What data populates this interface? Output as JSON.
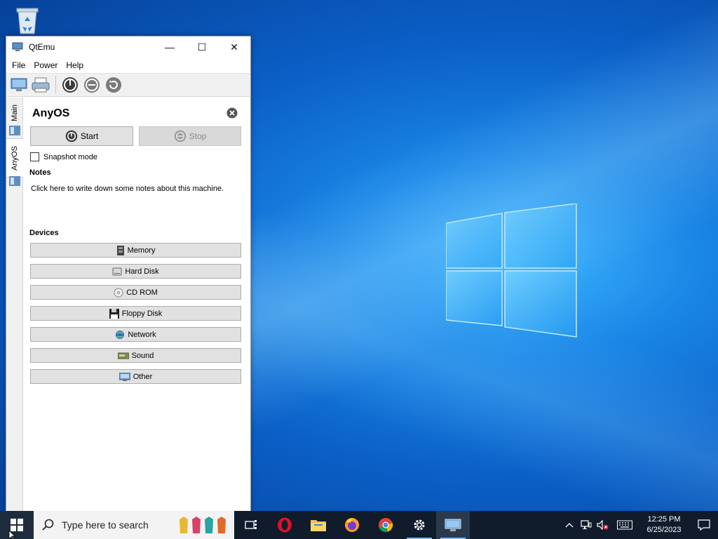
{
  "window": {
    "title": "QtEmu",
    "minimize_glyph": "—",
    "maximize_glyph": "☐",
    "close_glyph": "✕"
  },
  "menu": [
    "File",
    "Power",
    "Help"
  ],
  "toolbar_icons": [
    "new-machine-icon",
    "printer-icon",
    "power-on-icon",
    "pause-icon",
    "reset-icon"
  ],
  "side_tabs": [
    {
      "label": "Main"
    },
    {
      "label": "AnyOS"
    }
  ],
  "vm": {
    "name": "AnyOS",
    "start_label": "Start",
    "stop_label": "Stop",
    "snapshot_label": "Snapshot mode",
    "notes_title": "Notes",
    "notes_placeholder": "Click here to write down some notes about this machine.",
    "devices_title": "Devices"
  },
  "devices": [
    {
      "label": "Memory",
      "icon": "memory-icon"
    },
    {
      "label": "Hard Disk",
      "icon": "hard-disk-icon"
    },
    {
      "label": "CD ROM",
      "icon": "cd-rom-icon"
    },
    {
      "label": "Floppy Disk",
      "icon": "floppy-disk-icon"
    },
    {
      "label": "Network",
      "icon": "network-icon"
    },
    {
      "label": "Sound",
      "icon": "sound-icon"
    },
    {
      "label": "Other",
      "icon": "other-icon"
    }
  ],
  "taskbar": {
    "search_placeholder": "Type here to search",
    "apps": [
      "task-view-icon",
      "opera-icon",
      "file-explorer-icon",
      "firefox-icon",
      "chrome-icon",
      "settings-icon",
      "qtemu-icon"
    ],
    "time": "12:25 PM",
    "date": "6/25/2023"
  },
  "colors": {
    "accent": "#0078d7",
    "taskbar": "#101b2b",
    "button_face": "#e1e1e1"
  }
}
